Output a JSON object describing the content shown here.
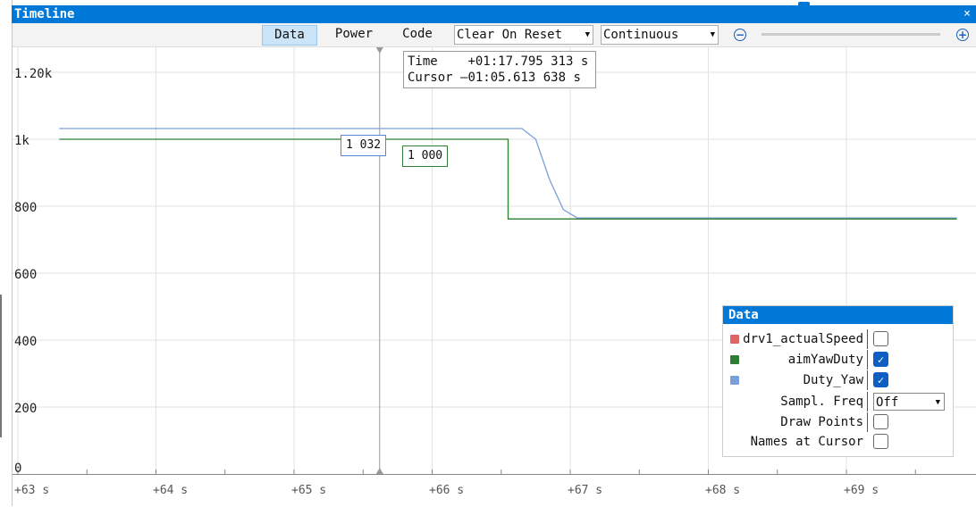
{
  "window": {
    "title": "Timeline",
    "close_glyph": "×"
  },
  "toolbar": {
    "tabs": [
      {
        "label": "Data",
        "active": true
      },
      {
        "label": "Power",
        "active": false
      },
      {
        "label": "Code",
        "active": false
      }
    ],
    "reset_mode": "Clear On Reset",
    "run_mode": "Continuous",
    "zoom_out_icon": "zoom-out-icon",
    "zoom_in_icon": "zoom-in-icon",
    "zoom_level": 0.3
  },
  "y_axis": {
    "labels": [
      "1.20k",
      "1k",
      "800",
      "600",
      "400",
      "200",
      "0"
    ]
  },
  "x_axis": {
    "labels": [
      "+63 s",
      "+64 s",
      "+65 s",
      "+66 s",
      "+67 s",
      "+68 s",
      "+69 s"
    ]
  },
  "cursor_tooltip": {
    "time_label": "Time",
    "time_value": "+01:17.795 313 s",
    "cursor_label": "Cursor",
    "cursor_value": "–01:05.613 638 s"
  },
  "value_labels": {
    "duty_yaw": "1 032",
    "aim_yaw_duty": "1 000"
  },
  "chart_data": {
    "type": "line",
    "xlim": [
      62.9,
      69.8
    ],
    "ylim": [
      0,
      1200
    ],
    "cursor_x": 65.62,
    "series": [
      {
        "name": "Duty_Yaw",
        "color": "#7a9fd9",
        "points": [
          [
            63.3,
            1032
          ],
          [
            66.65,
            1032
          ],
          [
            66.75,
            1000
          ],
          [
            66.85,
            880
          ],
          [
            66.95,
            790
          ],
          [
            67.05,
            765
          ],
          [
            69.8,
            765
          ]
        ]
      },
      {
        "name": "aimYawDuty",
        "color": "#2e7d32",
        "points": [
          [
            63.3,
            1000
          ],
          [
            66.55,
            1000
          ],
          [
            66.55,
            762
          ],
          [
            69.8,
            762
          ]
        ]
      }
    ]
  },
  "data_panel": {
    "title": "Data",
    "series_rows": [
      {
        "label": "drv1_actualSpeed",
        "color": "#e06666",
        "checked": false
      },
      {
        "label": "aimYawDuty",
        "color": "#2e7d32",
        "checked": true
      },
      {
        "label": "Duty_Yaw",
        "color": "#7a9fd9",
        "checked": true
      }
    ],
    "sample_freq_label": "Sampl. Freq",
    "sample_freq_value": "Off",
    "draw_points_label": "Draw Points",
    "draw_points_checked": false,
    "names_at_cursor_label": "Names at Cursor",
    "names_at_cursor_checked": false,
    "check_glyph": "✓"
  }
}
